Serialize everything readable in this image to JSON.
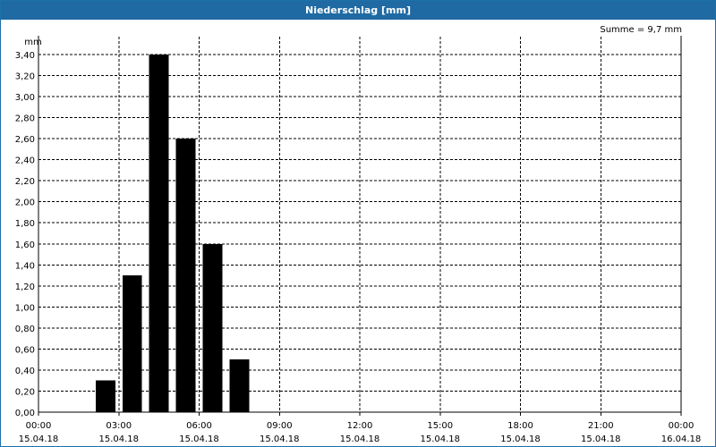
{
  "window": {
    "title": "Niederschlag [mm]"
  },
  "summary": "Summe = 9,7 mm",
  "colors": {
    "titlebar": "#1f6aa3",
    "bars": "#000000",
    "grid": "#000000"
  },
  "chart_data": {
    "type": "bar",
    "title": "Niederschlag [mm]",
    "ylabel": "mm",
    "xlabel": "",
    "ylim": [
      0,
      3.4
    ],
    "yticks": [
      "0,00",
      "0,20",
      "0,40",
      "0,60",
      "0,80",
      "1,00",
      "1,20",
      "1,40",
      "1,60",
      "1,80",
      "2,00",
      "2,20",
      "2,40",
      "2,60",
      "2,80",
      "3,00",
      "3,20",
      "3,40"
    ],
    "xticks": [
      {
        "time": "00:00",
        "date": "15.04.18"
      },
      {
        "time": "03:00",
        "date": "15.04.18"
      },
      {
        "time": "06:00",
        "date": "15.04.18"
      },
      {
        "time": "09:00",
        "date": "15.04.18"
      },
      {
        "time": "12:00",
        "date": "15.04.18"
      },
      {
        "time": "15:00",
        "date": "15.04.18"
      },
      {
        "time": "18:00",
        "date": "15.04.18"
      },
      {
        "time": "21:00",
        "date": "15.04.18"
      },
      {
        "time": "00:00",
        "date": "16.04.18"
      }
    ],
    "xrange_hours": [
      0,
      24
    ],
    "grid": true,
    "bars": [
      {
        "start_hour": 2,
        "end_hour": 3,
        "value": 0.3
      },
      {
        "start_hour": 3,
        "end_hour": 4,
        "value": 1.3
      },
      {
        "start_hour": 4,
        "end_hour": 5,
        "value": 3.4
      },
      {
        "start_hour": 5,
        "end_hour": 6,
        "value": 2.6
      },
      {
        "start_hour": 6,
        "end_hour": 7,
        "value": 1.6
      },
      {
        "start_hour": 7,
        "end_hour": 8,
        "value": 0.5
      }
    ]
  }
}
